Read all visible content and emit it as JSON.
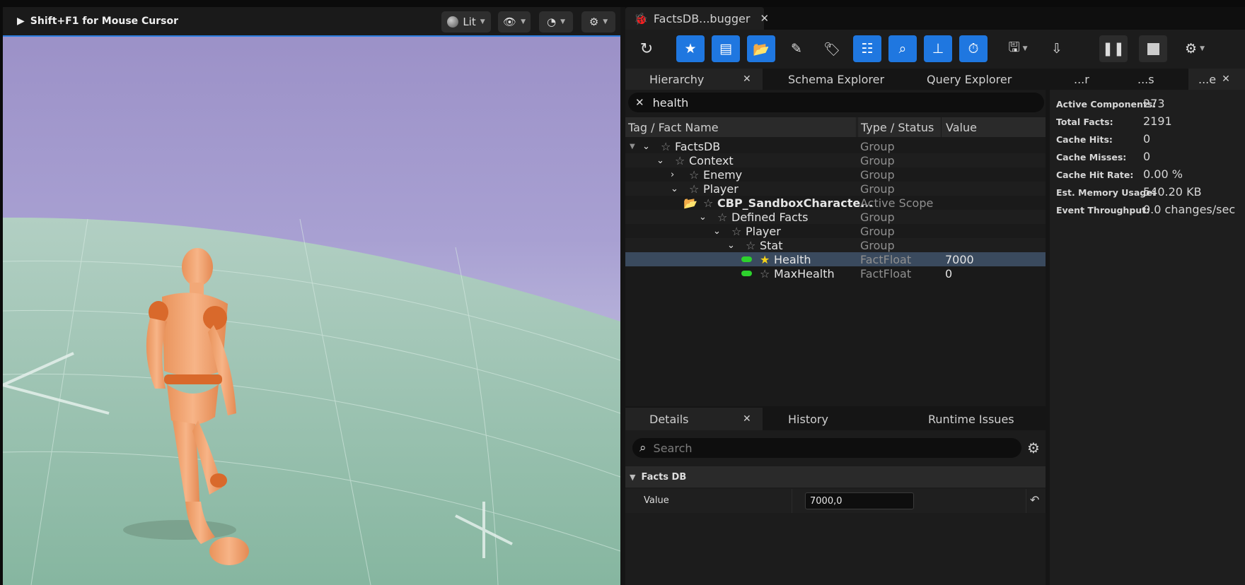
{
  "viewport": {
    "cursor_hint": "Shift+F1 for Mouse Cursor",
    "lit_label": "Lit"
  },
  "debugger": {
    "tab_title": "FactsDB...bugger",
    "subtabs": [
      "Hierarchy",
      "Schema Explorer",
      "Query Explorer",
      "...r",
      "...s",
      "...e"
    ],
    "search_value": "health",
    "columns": [
      "Tag / Fact Name",
      "Type / Status",
      "Value"
    ],
    "rows": [
      {
        "name": "FactsDB",
        "type": "Group",
        "value": ""
      },
      {
        "name": "Context",
        "type": "Group",
        "value": ""
      },
      {
        "name": "Enemy",
        "type": "Group",
        "value": ""
      },
      {
        "name": "Player",
        "type": "Group",
        "value": ""
      },
      {
        "name": "CBP_SandboxCharacte...",
        "type": "Active Scope",
        "value": ""
      },
      {
        "name": "Defined Facts",
        "type": "Group",
        "value": ""
      },
      {
        "name": "Player",
        "type": "Group",
        "value": ""
      },
      {
        "name": "Stat",
        "type": "Group",
        "value": ""
      },
      {
        "name": "Health",
        "type": "FactFloat",
        "value": "7000"
      },
      {
        "name": "MaxHealth",
        "type": "FactFloat",
        "value": "0"
      }
    ]
  },
  "stats": [
    {
      "label": "Active Components:",
      "value": "273"
    },
    {
      "label": "Total Facts:",
      "value": "2191"
    },
    {
      "label": "Cache Hits:",
      "value": "0"
    },
    {
      "label": "Cache Misses:",
      "value": "0"
    },
    {
      "label": "Cache Hit Rate:",
      "value": "0.00 %"
    },
    {
      "label": "Est. Memory Usage:",
      "value": "540.20 KB"
    },
    {
      "label": "Event Throughput:",
      "value": "0.0 changes/sec"
    }
  ],
  "details": {
    "tabs": [
      "Details",
      "History",
      "Runtime Issues"
    ],
    "search_placeholder": "Search",
    "category": "Facts DB",
    "value_label": "Value",
    "value": "7000,0"
  },
  "colors": {
    "accent": "#1f77e0",
    "selection": "#3a4a5e",
    "status_green": "#2dd12d"
  }
}
